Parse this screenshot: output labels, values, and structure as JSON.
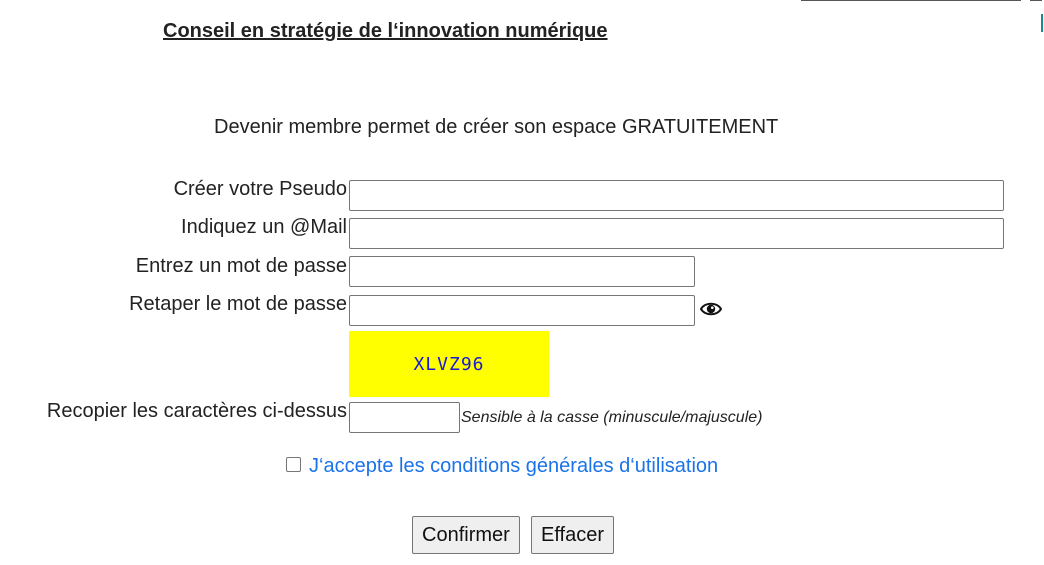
{
  "page": {
    "title": "Conseil en stratégie de l‘innovation numérique",
    "intro": "Devenir membre permet de créer son espace GRATUITEMENT"
  },
  "form": {
    "pseudo_label": "Créer votre Pseudo",
    "pseudo_value": "",
    "email_label": "Indiquez un @Mail",
    "email_value": "",
    "password_label": "Entrez un mot de passe",
    "password_value": "",
    "password_confirm_label": "Retaper le mot de passe",
    "password_confirm_value": "",
    "toggle_visibility_icon": "eye-icon",
    "captcha_code": "XLVZ96",
    "captcha_bg": "#ffff00",
    "captcha_color": "#1a1ad4",
    "captcha_label": "Recopier les caractères ci-dessus",
    "captcha_value": "",
    "captcha_hint": "Sensible à la casse (minuscule/majuscule)",
    "terms_checked": false,
    "terms_label": "J‘accepte les conditions générales d‘utilisation",
    "link_color": "#1a73e8"
  },
  "actions": {
    "confirm_label": "Confirmer",
    "reset_label": "Effacer"
  }
}
